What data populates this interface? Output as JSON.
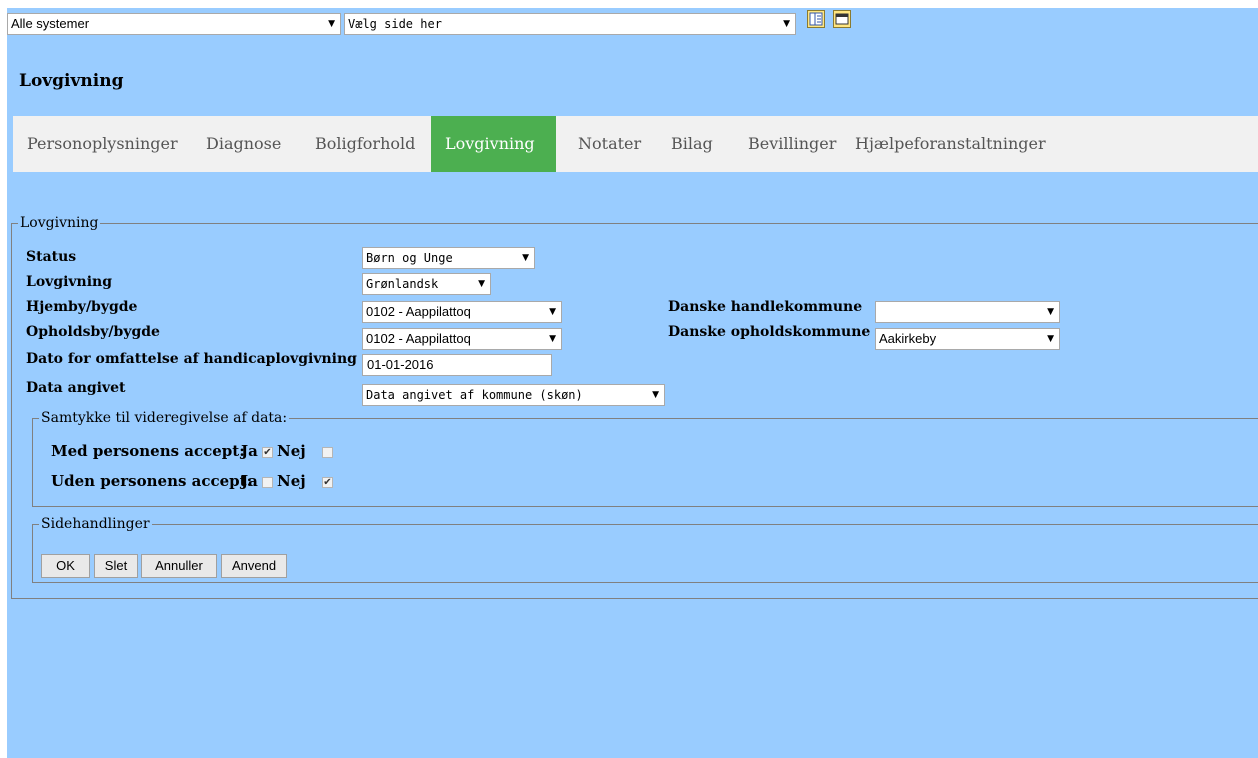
{
  "topbar": {
    "system_select": "Alle systemer",
    "page_select": "Vælg side her"
  },
  "page_title": "Lovgivning",
  "tabs": [
    {
      "label": "Personoplysninger"
    },
    {
      "label": "Diagnose"
    },
    {
      "label": "Boligforhold"
    },
    {
      "label": "Lovgivning"
    },
    {
      "label": "Notater"
    },
    {
      "label": "Bilag"
    },
    {
      "label": "Bevillinger"
    },
    {
      "label": "Hjælpeforanstaltninger"
    }
  ],
  "active_tab": "Lovgivning",
  "form": {
    "legend": "Lovgivning",
    "status": {
      "label": "Status",
      "value": "Børn og Unge"
    },
    "lovgivning": {
      "label": "Lovgivning",
      "value": "Grønlandsk"
    },
    "hjemby": {
      "label": "Hjemby/bygde",
      "value": "0102 - Aappilattoq"
    },
    "opholdsby": {
      "label": "Opholdsby/bygde",
      "value": "0102 - Aappilattoq"
    },
    "dato": {
      "label": "Dato for omfattelse af handicaplovgivning",
      "value": "01-01-2016"
    },
    "data_angivet": {
      "label": "Data angivet",
      "value": "Data angivet af kommune (skøn)"
    },
    "handlekommune": {
      "label": "Danske handlekommune",
      "value": ""
    },
    "opholdskommune": {
      "label": "Danske opholdskommune",
      "value": "Aakirkeby"
    }
  },
  "consent": {
    "legend": "Samtykke til videregivelse af data:",
    "with_label": "Med personens accept:",
    "without_label": "Uden personens accept:",
    "ja": "Ja",
    "nej": "Nej",
    "with_ja": true,
    "with_nej": false,
    "without_ja": false,
    "without_nej": true
  },
  "actions": {
    "legend": "Sidehandlinger",
    "ok": "OK",
    "delete": "Slet",
    "cancel": "Annuller",
    "apply": "Anvend"
  },
  "colors": {
    "background": "#99ccff",
    "active_tab": "#4caf50",
    "tab_bar": "#f1f1f1"
  }
}
